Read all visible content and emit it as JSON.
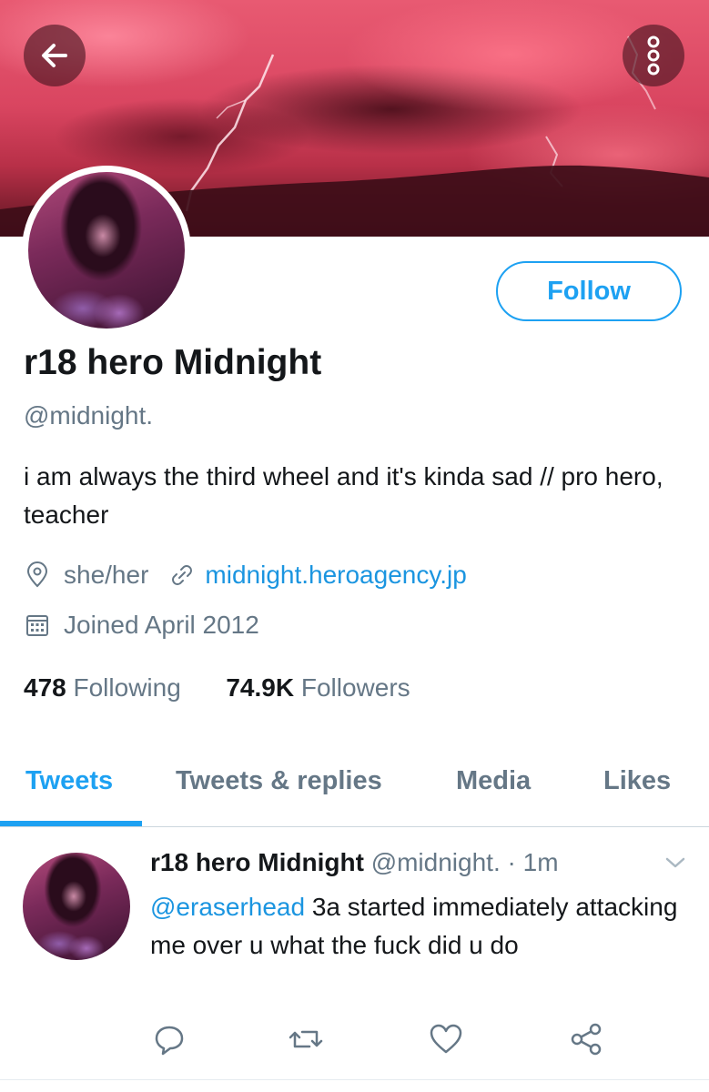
{
  "profile": {
    "display_name": "r18 hero Midnight",
    "handle": "@midnight.",
    "bio": "i am always the third wheel and it's kinda sad // pro hero, teacher",
    "location": "she/her",
    "website": "midnight.heroagency.jp",
    "joined": "Joined April 2012",
    "following_count": "478",
    "following_label": "Following",
    "followers_count": "74.9K",
    "followers_label": "Followers",
    "follow_label": "Follow"
  },
  "tabs": [
    {
      "label": "Tweets",
      "active": true
    },
    {
      "label": "Tweets & replies",
      "active": false
    },
    {
      "label": "Media",
      "active": false
    },
    {
      "label": "Likes",
      "active": false
    }
  ],
  "tweet": {
    "author": "r18 hero Midnight",
    "handle": "@midnight.",
    "separator": "·",
    "time": "1m",
    "mention": "@eraserhead",
    "text": " 3a started immediately attacking me over u what the fuck did u do"
  },
  "icons": {
    "back": "arrow-left-icon",
    "more": "more-vertical-icon",
    "location": "location-pin-icon",
    "link": "link-icon",
    "calendar": "calendar-icon",
    "caret": "chevron-down-icon",
    "reply": "reply-icon",
    "retweet": "retweet-icon",
    "like": "heart-icon",
    "share": "share-icon"
  },
  "colors": {
    "accent": "#1da1f2",
    "link": "#1b95e0",
    "secondary_text": "#657786",
    "primary_text": "#14171a"
  }
}
